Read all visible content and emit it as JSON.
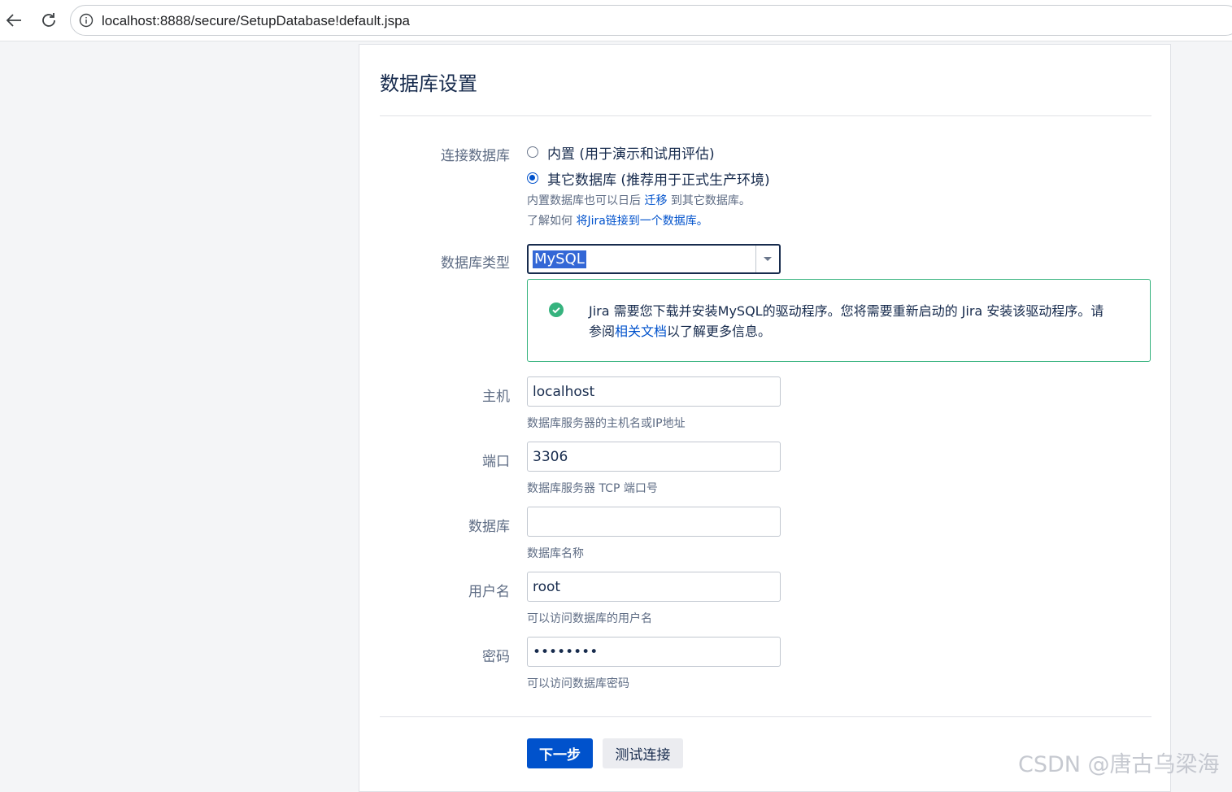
{
  "browser": {
    "url": "localhost:8888/secure/SetupDatabase!default.jspa"
  },
  "page": {
    "title": "数据库设置"
  },
  "connection": {
    "label": "连接数据库",
    "options": [
      {
        "label": "内置 (用于演示和试用评估)",
        "checked": false
      },
      {
        "label": "其它数据库 (推荐用于正式生产环境)",
        "checked": true
      }
    ],
    "help1_prefix": "内置数据库也可以日后",
    "help1_link": "迁移",
    "help1_suffix": "到其它数据库。",
    "help2_prefix": "了解如何",
    "help2_link": "将Jira链接到一个数据库。"
  },
  "db_type": {
    "label": "数据库类型",
    "value": "MySQL"
  },
  "notice": {
    "text_prefix": "Jira 需要您下载并安装MySQL的驱动程序。您将需要重新启动的 Jira 安装该驱动程序。请参阅",
    "link": "相关文档",
    "text_suffix": "以了解更多信息。",
    "icon": "check-circle-icon",
    "border_color": "#36b37e"
  },
  "fields": {
    "host": {
      "label": "主机",
      "value": "localhost",
      "help": "数据库服务器的主机名或IP地址"
    },
    "port": {
      "label": "端口",
      "value": "3306",
      "help": "数据库服务器 TCP 端口号"
    },
    "database": {
      "label": "数据库",
      "value": "",
      "help": "数据库名称"
    },
    "username": {
      "label": "用户名",
      "value": "root",
      "help": "可以访问数据库的用户名"
    },
    "password": {
      "label": "密码",
      "value": "12345678",
      "help": "可以访问数据库密码"
    }
  },
  "buttons": {
    "next": "下一步",
    "test": "测试连接"
  },
  "watermark": "CSDN @唐古乌梁海",
  "colors": {
    "primary": "#0052cc",
    "success": "#36b37e",
    "text": "#172b4d",
    "muted": "#5e6c84"
  }
}
